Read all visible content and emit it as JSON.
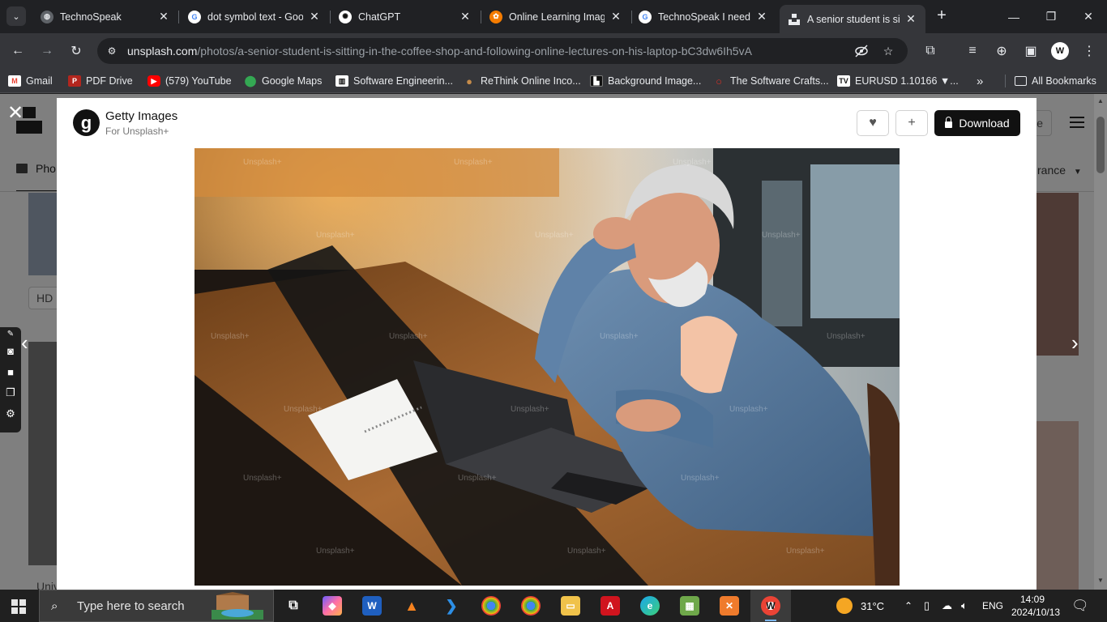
{
  "browser": {
    "tabs": [
      {
        "title": "TechnoSpeak",
        "icon": "globe-icon"
      },
      {
        "title": "dot symbol text - Goo",
        "icon": "google-icon"
      },
      {
        "title": "ChatGPT",
        "icon": "chatgpt-icon"
      },
      {
        "title": "Online Learning Imag",
        "icon": "online-learning-icon"
      },
      {
        "title": "TechnoSpeak I need a",
        "icon": "google-icon"
      },
      {
        "title": "A senior student is sit",
        "icon": "unsplash-icon",
        "active": true
      }
    ],
    "url_host": "unsplash.com",
    "url_path": "/photos/a-senior-student-is-sitting-in-the-coffee-shop-and-following-online-lectures-on-his-laptop-bC3dw6Ih5vA",
    "bookmarks": [
      {
        "label": "Gmail",
        "icon": "gmail-icon",
        "color": "#ea4335"
      },
      {
        "label": "PDF Drive",
        "icon": "pdf-drive-icon",
        "color": "#b3261e"
      },
      {
        "label": "(579) YouTube",
        "icon": "youtube-icon",
        "color": "#ff0000"
      },
      {
        "label": "Google Maps",
        "icon": "maps-pin-icon",
        "color": "#34a853"
      },
      {
        "label": "Software Engineerin...",
        "icon": "bookmark-icon",
        "color": "#ffffff"
      },
      {
        "label": "ReThink Online Inco...",
        "icon": "bookmark-icon",
        "color": "#c58b4a"
      },
      {
        "label": "Background Image...",
        "icon": "bookmark-icon",
        "color": "#111111"
      },
      {
        "label": "The Software Crafts...",
        "icon": "bookmark-icon",
        "color": "#d93025"
      },
      {
        "label": "EURUSD 1.10166 ▼...",
        "icon": "tradingview-icon",
        "color": "#111111"
      }
    ],
    "more_bookmarks": "»",
    "all_bookmarks": "All Bookmarks"
  },
  "page": {
    "bg_photos_label": "Pho",
    "bg_hd_label": "HD",
    "bg_ance_label": "rance",
    "bg_e_label": "e",
    "bg_univ_label": "Univ",
    "modal": {
      "author": "Getty Images",
      "author_sub": "For Unsplash+",
      "download_label": "Download",
      "watermark": "Unsplash+"
    }
  },
  "taskbar": {
    "search_placeholder": "Type here to search",
    "weather": "31°C",
    "language": "ENG",
    "time": "14:09",
    "date": "2024/10/13"
  },
  "colors": {
    "chrome_dark": "#202124",
    "chrome_toolbar": "#35363a",
    "download_button": "#111111",
    "page_dim": "#7f7f7f"
  }
}
